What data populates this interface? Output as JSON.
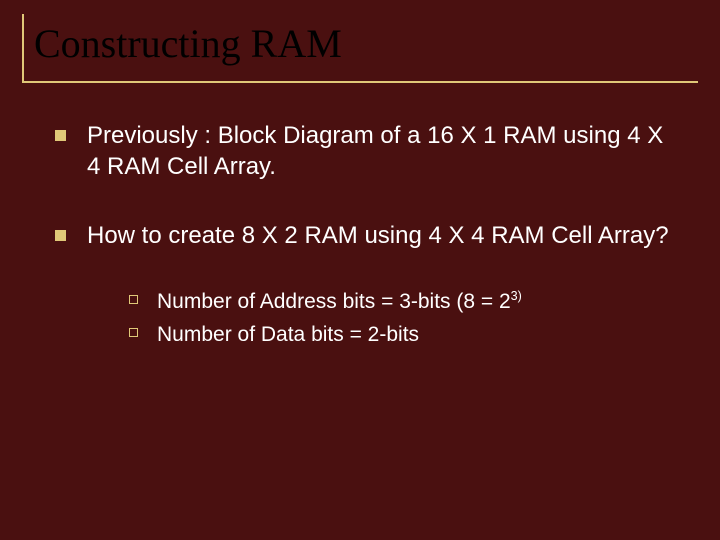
{
  "title": "Constructing RAM",
  "bullets": [
    {
      "text": "Previously : Block Diagram of a 16 X 1 RAM using 4 X 4 RAM Cell Array."
    },
    {
      "text": "How to create 8 X 2 RAM using 4 X 4 RAM Cell Array?",
      "sub": [
        {
          "pre": "Number of Address bits = 3-bits  (8 = 2",
          "sup": "3)",
          "post": ""
        },
        {
          "pre": "Number of Data bits = 2-bits",
          "sup": "",
          "post": ""
        }
      ]
    }
  ]
}
